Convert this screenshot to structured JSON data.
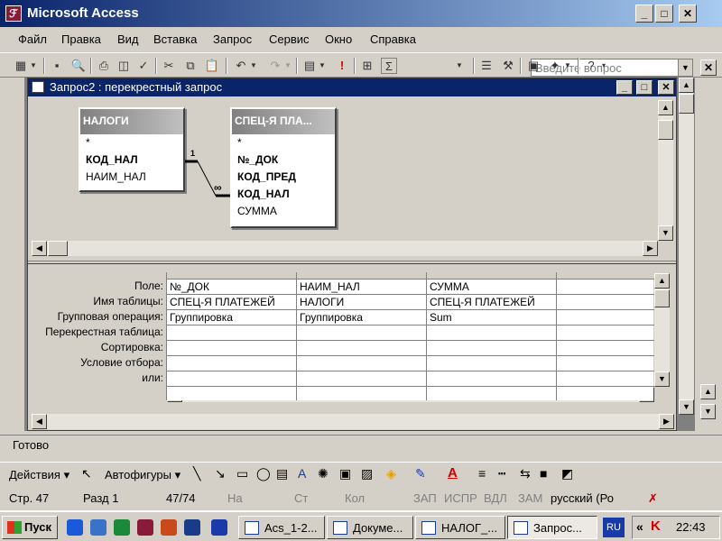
{
  "app": {
    "title": "Microsoft Access"
  },
  "menu": {
    "items": [
      "Файл",
      "Правка",
      "Вид",
      "Вставка",
      "Запрос",
      "Сервис",
      "Окно",
      "Справка"
    ],
    "help_placeholder": "Введите вопрос"
  },
  "query_window": {
    "title": "Запрос2 : перекрестный запрос"
  },
  "tables": {
    "nalogi": {
      "header": "НАЛОГИ",
      "fields": [
        "*",
        "КОД_НАЛ",
        "НАИМ_НАЛ"
      ]
    },
    "spec": {
      "header": "СПЕЦ-Я ПЛА...",
      "fields": [
        "*",
        "№_ДОК",
        "КОД_ПРЕД",
        "КОД_НАЛ",
        "СУММА"
      ]
    },
    "relation": {
      "one": "1",
      "many": "∞"
    }
  },
  "grid": {
    "row_labels": [
      "Поле:",
      "Имя таблицы:",
      "Групповая операция:",
      "Перекрестная таблица:",
      "Сортировка:",
      "Условие отбора:",
      "или:"
    ],
    "columns": [
      {
        "field": "№_ДОК",
        "table": "СПЕЦ-Я ПЛАТЕЖЕЙ",
        "group": "Группировка"
      },
      {
        "field": "НАИМ_НАЛ",
        "table": "НАЛОГИ",
        "group": "Группировка"
      },
      {
        "field": "СУММА",
        "table": "СПЕЦ-Я ПЛАТЕЖЕЙ",
        "group": "Sum"
      },
      {
        "field": "",
        "table": "",
        "group": ""
      }
    ]
  },
  "status": {
    "text": "Готово"
  },
  "drawing": {
    "actions": "Действия",
    "autoshapes": "Автофигуры"
  },
  "docstats": {
    "page": "Стр. 47",
    "section": "Разд 1",
    "pages": "47/74",
    "at": "На",
    "line": "Ст",
    "col": "Кол",
    "rec": "ЗАП",
    "trk": "ИСПР",
    "ext": "ВДЛ",
    "ovr": "ЗАМ",
    "lang": "русский (Ро"
  },
  "taskbar": {
    "start": "Пуск",
    "tasks": [
      "Acs_1-2...",
      "Докуме...",
      "НАЛОГ_...",
      "Запрос..."
    ],
    "lang": "RU",
    "clock": "22:43"
  }
}
